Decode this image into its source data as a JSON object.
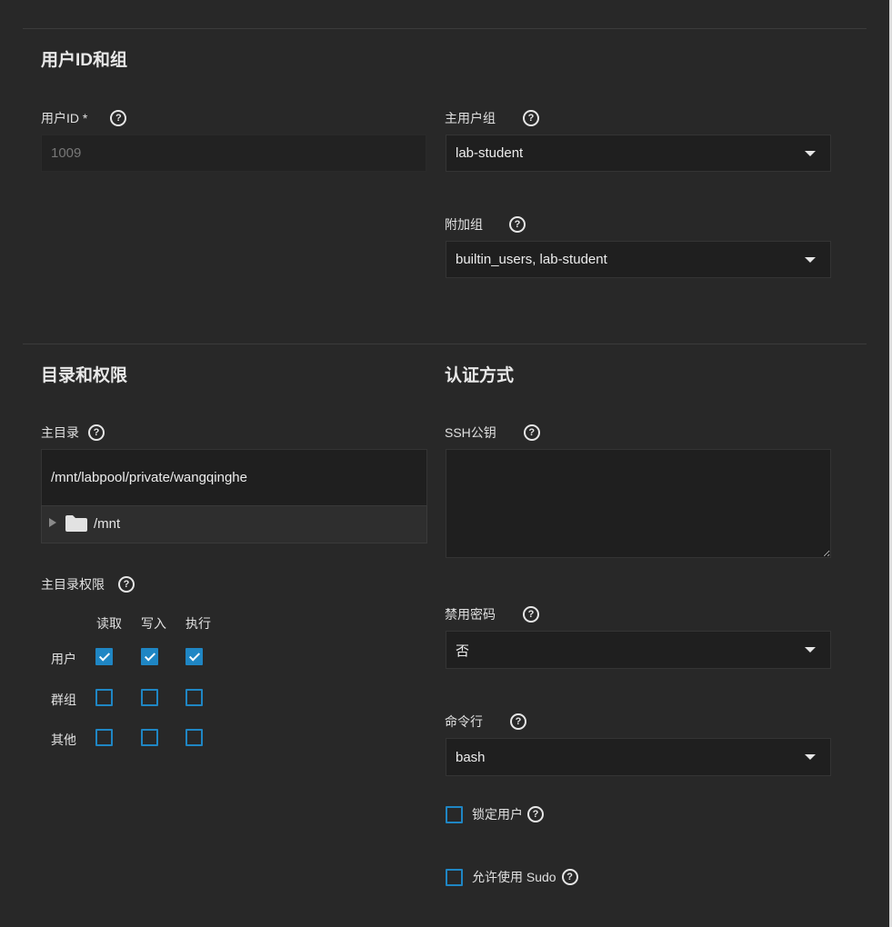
{
  "sections": {
    "user_id_group": "用户ID和组",
    "directory_permissions": "目录和权限",
    "authentication": "认证方式"
  },
  "user_id": {
    "label": "用户ID *",
    "value": "1009"
  },
  "primary_group": {
    "label": "主用户组",
    "value": "lab-student"
  },
  "aux_groups": {
    "label": "附加组",
    "value": "builtin_users, lab-student"
  },
  "home_dir": {
    "label": "主目录",
    "value": "/mnt/labpool/private/wangqinghe",
    "tree_root": "/mnt"
  },
  "home_perms": {
    "label": "主目录权限",
    "columns": [
      "读取",
      "写入",
      "执行"
    ],
    "rows": [
      {
        "name": "用户",
        "values": [
          true,
          true,
          true
        ]
      },
      {
        "name": "群组",
        "values": [
          false,
          false,
          false
        ]
      },
      {
        "name": "其他",
        "values": [
          false,
          false,
          false
        ]
      }
    ]
  },
  "ssh_key": {
    "label": "SSH公钥",
    "value": ""
  },
  "disable_password": {
    "label": "禁用密码",
    "value": "否"
  },
  "shell": {
    "label": "命令行",
    "value": "bash"
  },
  "lock_user": {
    "label": "锁定用户",
    "checked": false
  },
  "allow_sudo": {
    "label": "允许使用 Sudo",
    "checked": false
  },
  "help_glyph": "?",
  "icons": {
    "help": "help-circle-icon",
    "folder": "folder-icon",
    "expand": "triangle-right-icon",
    "dropdown": "caret-down-icon"
  },
  "colors": {
    "accent": "#1f86c4",
    "background": "#282828",
    "field": "#1f1f1f"
  }
}
